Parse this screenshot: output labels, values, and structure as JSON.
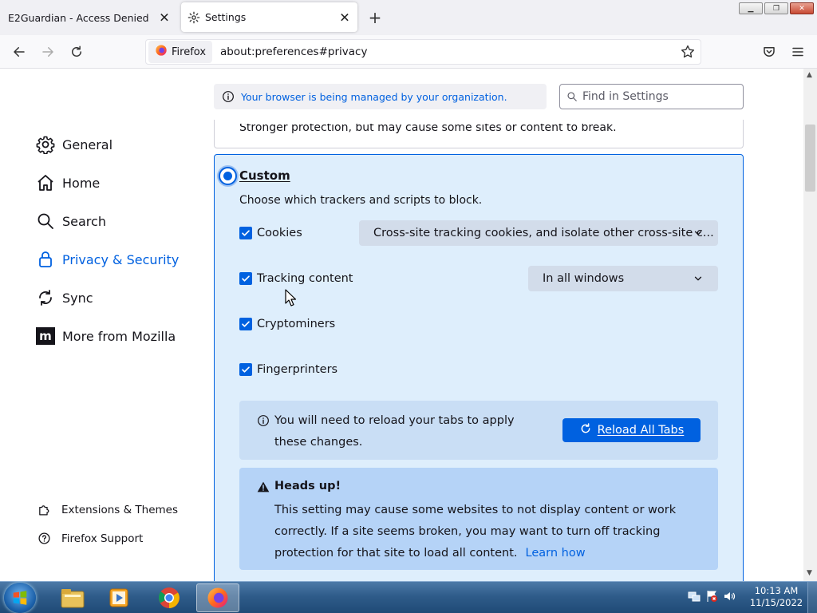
{
  "browser": {
    "tabs": [
      {
        "title": "E2Guardian - Access Denied",
        "active": false
      },
      {
        "title": "Settings",
        "active": true
      }
    ],
    "identity_label": "Firefox",
    "url": "about:preferences#privacy"
  },
  "sidebar": {
    "categories": [
      {
        "label": "General",
        "icon": "gear-icon"
      },
      {
        "label": "Home",
        "icon": "home-icon"
      },
      {
        "label": "Search",
        "icon": "search-icon"
      },
      {
        "label": "Privacy & Security",
        "icon": "lock-icon",
        "selected": true
      },
      {
        "label": "Sync",
        "icon": "sync-icon"
      },
      {
        "label": "More from Mozilla",
        "icon": "mozilla-icon"
      }
    ],
    "footer": [
      {
        "label": "Extensions & Themes",
        "icon": "puzzle-icon"
      },
      {
        "label": "Firefox Support",
        "icon": "help-icon"
      }
    ]
  },
  "header": {
    "managed_notice": "Your browser is being managed by your organization.",
    "find_placeholder": "Find in Settings"
  },
  "protection": {
    "standard_desc_partial": "Stronger protection, but may cause some sites or content to break.",
    "custom_label": "Custom",
    "custom_desc": "Choose which trackers and scripts to block.",
    "options": [
      {
        "label": "Cookies",
        "checked": true,
        "select": "Cross-site tracking cookies, and isolate other cross-site c..."
      },
      {
        "label": "Tracking content",
        "checked": true,
        "select": "In all windows"
      },
      {
        "label": "Cryptominers",
        "checked": true
      },
      {
        "label": "Fingerprinters",
        "checked": true
      }
    ],
    "reload_notice": "You will need to reload your tabs to apply these changes.",
    "reload_button": "Reload All Tabs",
    "heads_up_title": "Heads up!",
    "heads_up_body": "This setting may cause some websites to not display content or work correctly. If a site seems broken, you may want to turn off tracking protection for that site to load all content.",
    "learn_how": "Learn how"
  },
  "taskbar": {
    "time": "10:13 AM",
    "date": "11/15/2022"
  },
  "colors": {
    "accent": "#0061e0",
    "custom_bg": "#deeefc",
    "taskbar": "#2f5c8a"
  }
}
